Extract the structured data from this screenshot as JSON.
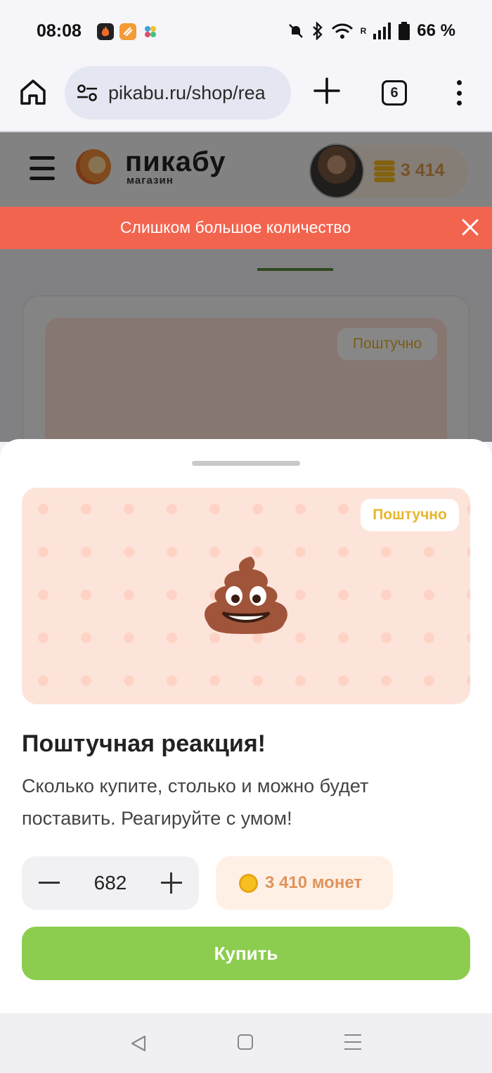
{
  "status_bar": {
    "time": "08:08",
    "battery": "66 %",
    "network_label": "R",
    "icons": [
      "fire-app-icon",
      "orange-app-icon",
      "dots-app-icon",
      "mute-icon",
      "bluetooth-icon",
      "wifi-icon",
      "signal-icon",
      "battery-icon"
    ]
  },
  "browser": {
    "url": "pikabu.ru/shop/rea",
    "tab_count": "6"
  },
  "site_header": {
    "logo_text": "пикабу",
    "logo_subtitle": "магазин",
    "balance": "3 414"
  },
  "error_banner": {
    "text": "Слишком большое количество"
  },
  "background_card": {
    "badge": "Поштучно"
  },
  "sheet": {
    "badge": "Поштучно",
    "emoji": "pile-of-poo",
    "title": "Поштучная реакция!",
    "description": "Сколько купите, столько и можно будет поставить. Реагируйте с умом!",
    "quantity": "682",
    "price": "3 410 монет",
    "buy_label": "Купить"
  },
  "colors": {
    "accent_green": "#8ccd4f",
    "error_red": "#f3644f",
    "badge_yellow": "#e8b52c",
    "coin_orange": "#e0935a"
  }
}
